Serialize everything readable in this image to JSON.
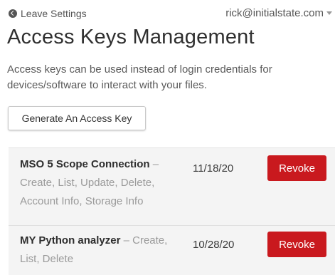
{
  "header": {
    "back_label": "Leave Settings",
    "account_email": "rick@initialstate.com"
  },
  "page": {
    "title": "Access Keys Management",
    "description": "Access keys can be used instead of login credentials for devices/software to interact with your files.",
    "generate_button_label": "Generate An Access Key"
  },
  "access_keys": [
    {
      "name": "MSO 5 Scope Connection",
      "separator": " – ",
      "permissions": "Create, List, Update, Delete, Account Info, Storage Info",
      "date": "11/18/20",
      "action_label": "Revoke"
    },
    {
      "name": "MY Python analyzer",
      "separator": " – ",
      "permissions": "Create, List, Delete",
      "date": "10/28/20",
      "action_label": "Revoke"
    }
  ],
  "colors": {
    "revoke_button": "#c9191e",
    "list_background": "#f4f4f4",
    "permission_text": "#9a9a9a"
  },
  "icons": {
    "back": "back-arrow-circle-icon",
    "account_menu": "chevron-down-icon"
  }
}
